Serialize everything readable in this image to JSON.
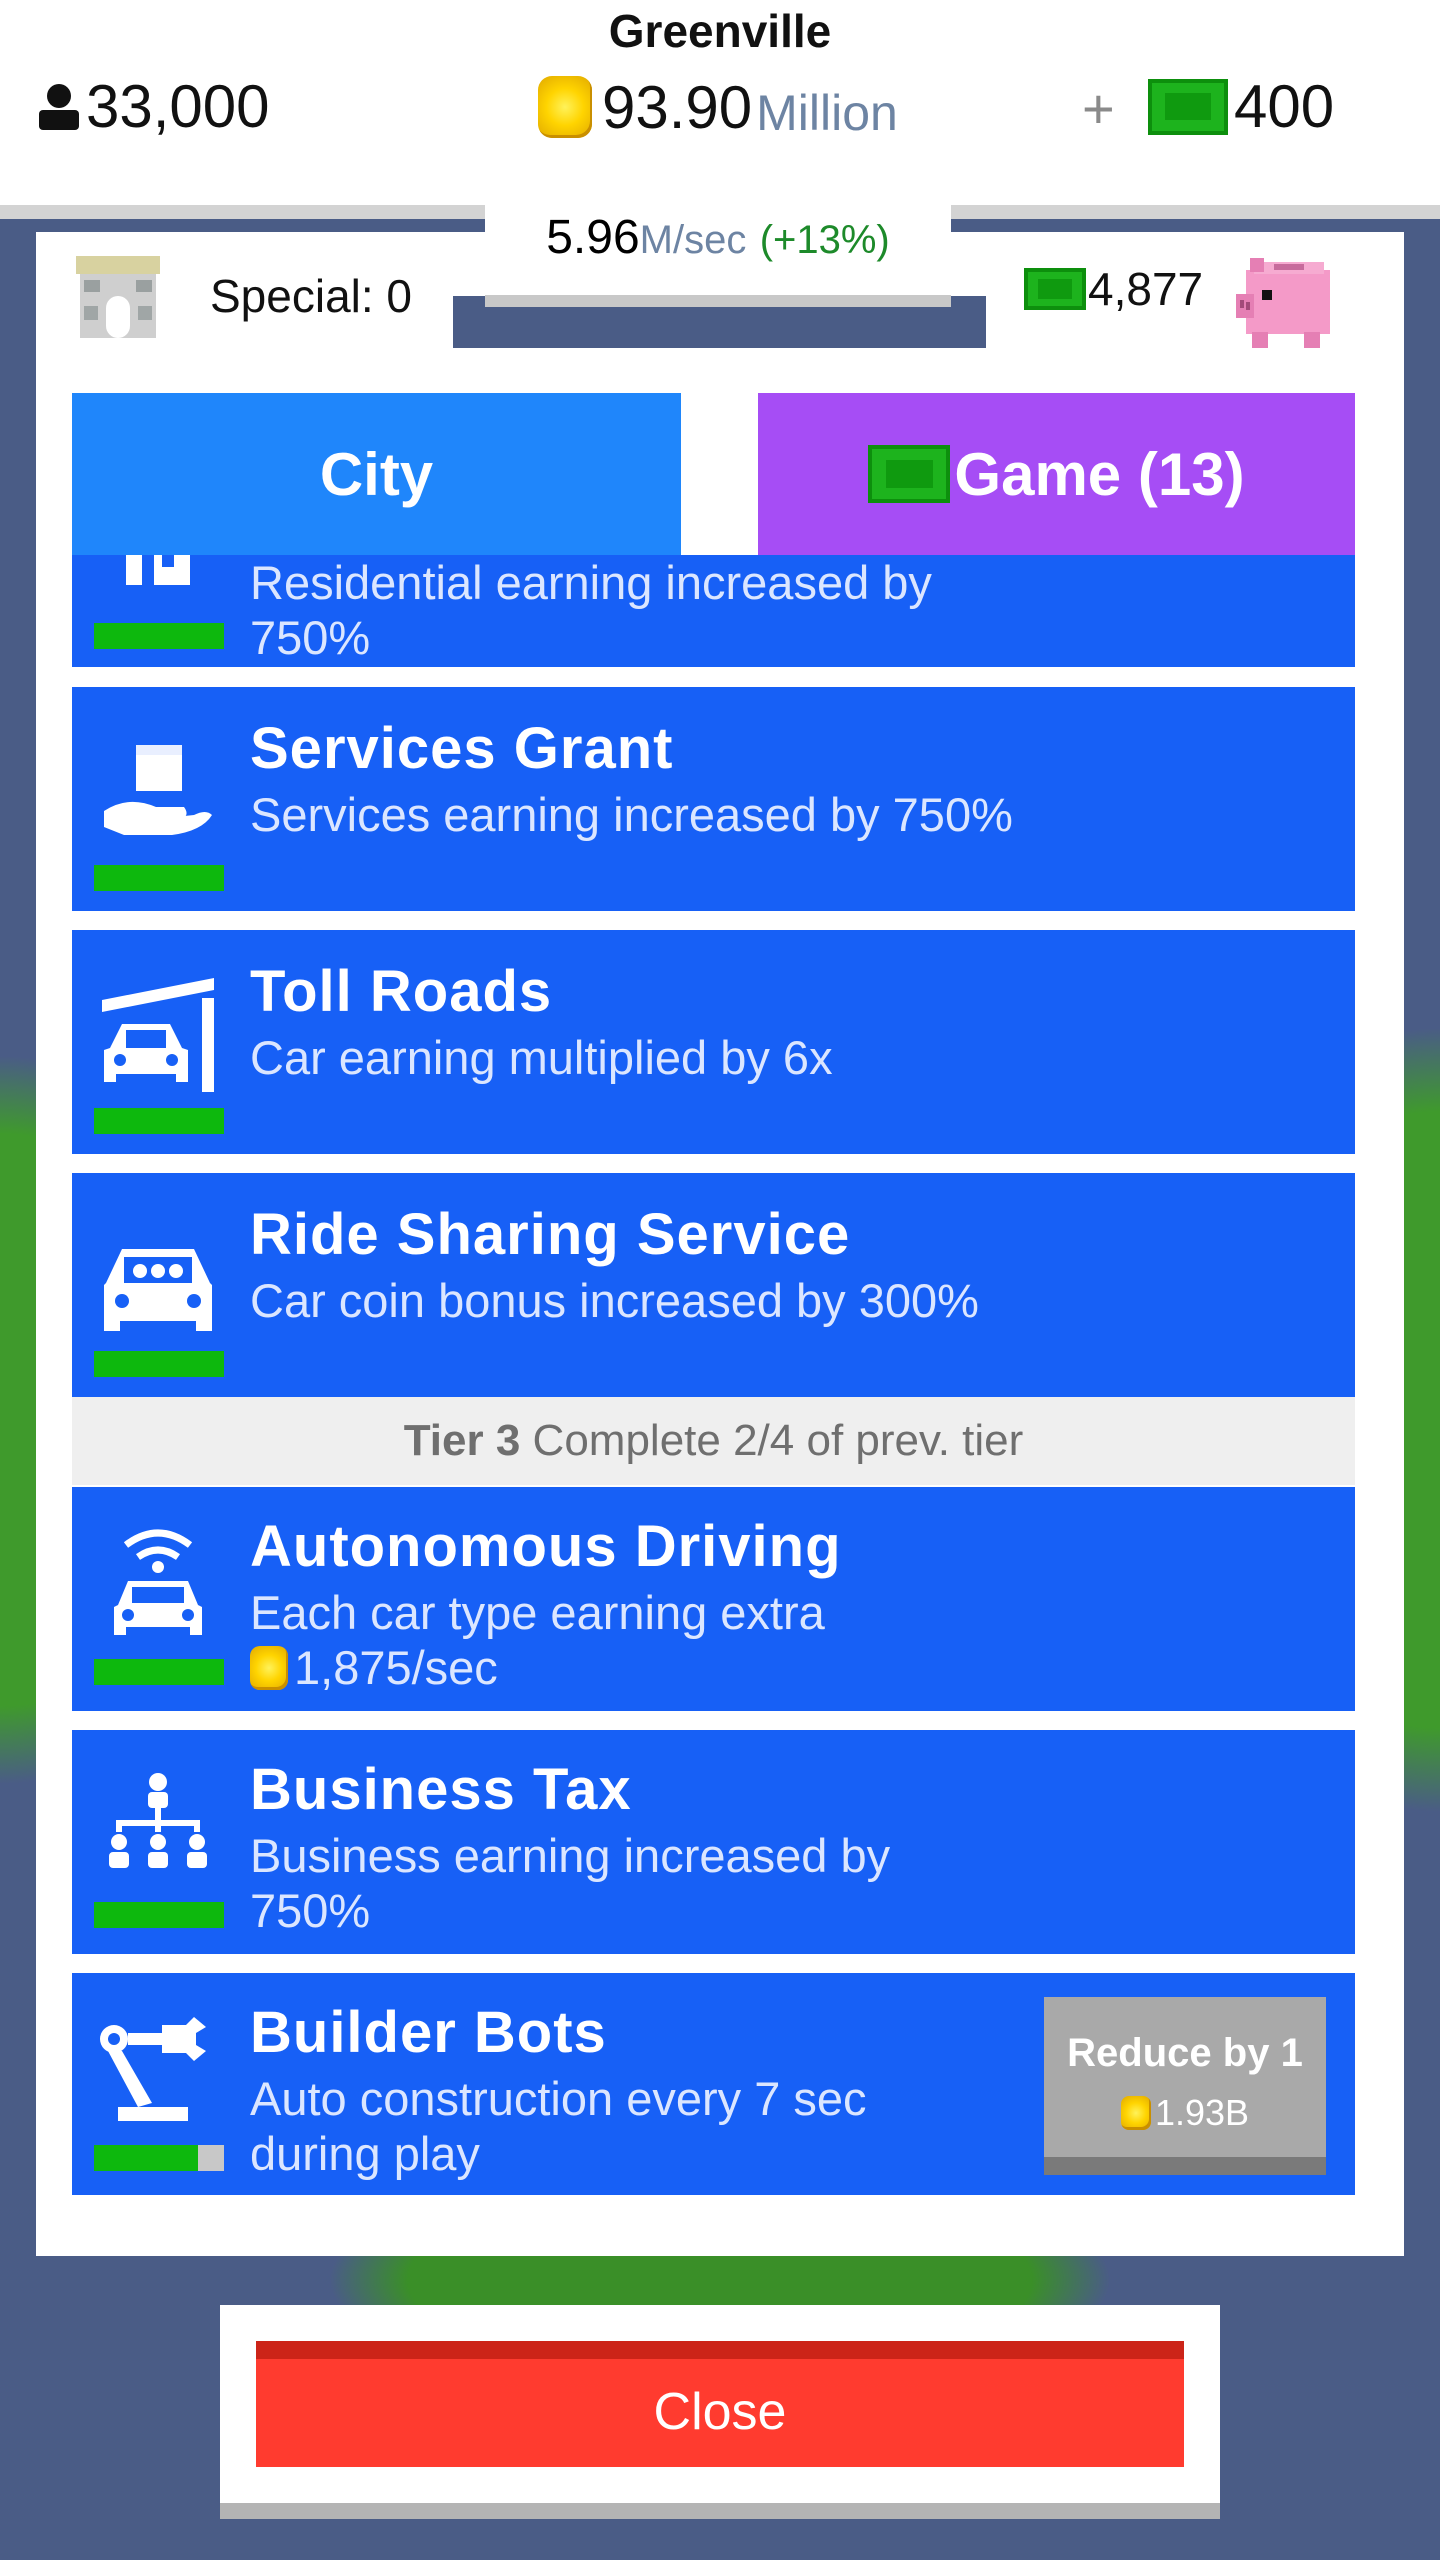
{
  "header": {
    "city_name": "Greenville",
    "population": "33,000",
    "money_value": "93.90",
    "money_suffix": "Million",
    "plus_label": "+",
    "cash": "400"
  },
  "rate": {
    "value": "5.96",
    "unit": "M/sec",
    "bonus": "(+13%)"
  },
  "special": {
    "label": "Special: 0"
  },
  "gems": {
    "value": "4,877"
  },
  "tabs": {
    "city": "City",
    "game": "Game (13)"
  },
  "items": [
    {
      "title": "",
      "desc1": "Residential earning increased by",
      "desc2": "750%",
      "progress": 1.0
    },
    {
      "title": "Services Grant",
      "desc1": "Services earning increased by 750%",
      "desc2": "",
      "progress": 1.0
    },
    {
      "title": "Toll Roads",
      "desc1": "Car earning multiplied by 6x",
      "desc2": "",
      "progress": 1.0
    },
    {
      "title": "Ride Sharing Service",
      "desc1": "Car coin bonus increased by 300%",
      "desc2": "",
      "progress": 1.0
    },
    {
      "title": "Autonomous Driving",
      "desc1": "Each car type earning extra",
      "desc2": "1,875/sec",
      "progress": 1.0
    },
    {
      "title": "Business Tax",
      "desc1": "Business earning increased by",
      "desc2": "750%",
      "progress": 1.0
    },
    {
      "title": "Builder Bots",
      "desc1": "Auto construction every 7 sec",
      "desc2": "during play",
      "progress": 0.8
    }
  ],
  "tier": {
    "name": "Tier 3",
    "requirement": "Complete 2/4 of prev. tier"
  },
  "reduce": {
    "label": "Reduce by 1",
    "cost": "1.93B"
  },
  "close": {
    "label": "Close"
  },
  "colors": {
    "item_bg": "#1760f6",
    "tab_city": "#1f86fb",
    "tab_game": "#a64df5",
    "progress": "#0db80d",
    "close": "#ff3b2f"
  }
}
